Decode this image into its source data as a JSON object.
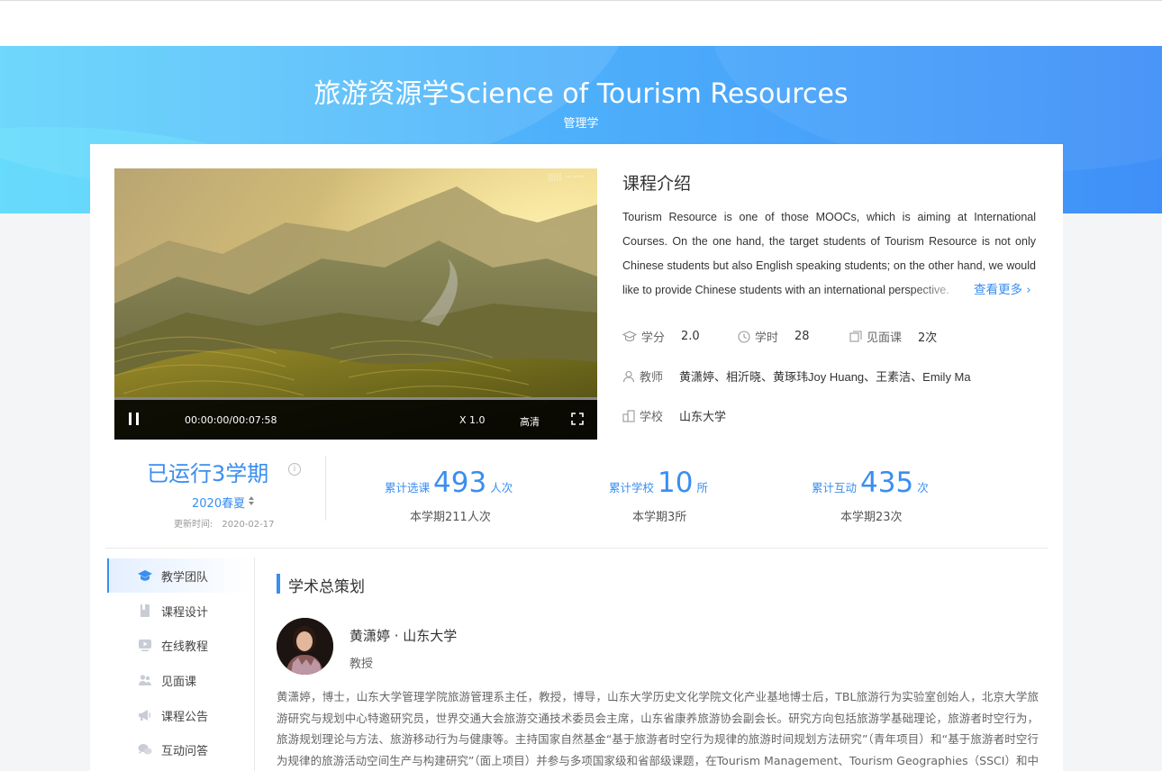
{
  "course": {
    "title": "旅游资源学Science of Tourism Resources",
    "category": "管理学"
  },
  "video": {
    "time": "00:00:00/00:07:58",
    "speed": "X 1.0",
    "quality": "高清"
  },
  "intro": {
    "heading": "课程介绍",
    "text": "Tourism Resource is one of those MOOCs, which is aiming at International Courses. On the one hand, the target students of Tourism Resource is not only Chinese students but also English speaking students; on the other hand, we would like to provide Chinese students with an international perspective.",
    "more": "查看更多"
  },
  "meta": {
    "credit_label": "学分",
    "credit": "2.0",
    "hours_label": "学时",
    "hours": "28",
    "meet_label": "见面课",
    "meet": "2次",
    "teacher_label": "教师",
    "teachers": "黄潇婷、相沂晓、黄琢玮Joy Huang、王素洁、Emily Ma",
    "school_label": "学校",
    "school": "山东大学"
  },
  "run": {
    "title": "已运行3学期",
    "term": "2020春夏",
    "update_label": "更新时间:",
    "update_date": "2020-02-17"
  },
  "stats": [
    {
      "label": "累计选课",
      "num": "493",
      "unit": "人次",
      "sub": "本学期211人次"
    },
    {
      "label": "累计学校",
      "num": "10",
      "unit": "所",
      "sub": "本学期3所"
    },
    {
      "label": "累计互动",
      "num": "435",
      "unit": "次",
      "sub": "本学期23次"
    }
  ],
  "nav": [
    {
      "label": "教学团队",
      "icon": "graduation-cap-icon"
    },
    {
      "label": "课程设计",
      "icon": "book-icon"
    },
    {
      "label": "在线教程",
      "icon": "video-play-icon"
    },
    {
      "label": "见面课",
      "icon": "people-icon"
    },
    {
      "label": "课程公告",
      "icon": "megaphone-icon"
    },
    {
      "label": "互动问答",
      "icon": "chat-bubbles-icon"
    }
  ],
  "section": {
    "title": "学术总策划",
    "teacher_name": "黄潇婷 · 山东大学",
    "teacher_title": "教授",
    "bio": "黄潇婷，博士，山东大学管理学院旅游管理系主任，教授，博导，山东大学历史文化学院文化产业基地博士后，TBL旅游行为实验室创始人，北京大学旅游研究与规划中心特邀研究员，世界交通大会旅游交通技术委员会主席，山东省康养旅游协会副会长。研究方向包括旅游学基础理论，旅游者时空行为，旅游规划理论与方法、旅游移动行为与健康等。主持国家自然基金“基于旅游者时空行为规律的旅游时间规划方法研究”（青年项目）和“基于旅游者时空行为规律的旅游活动空间生产与构建研究”（面上项目）并参与多项国家级和省部级课题，在Tourism Management、Tourism Geographies（SSCI）和中文"
  },
  "colors": {
    "accent": "#3a8ef0",
    "banner_start": "#5fd3fb",
    "banner_end": "#3f8ff8"
  }
}
